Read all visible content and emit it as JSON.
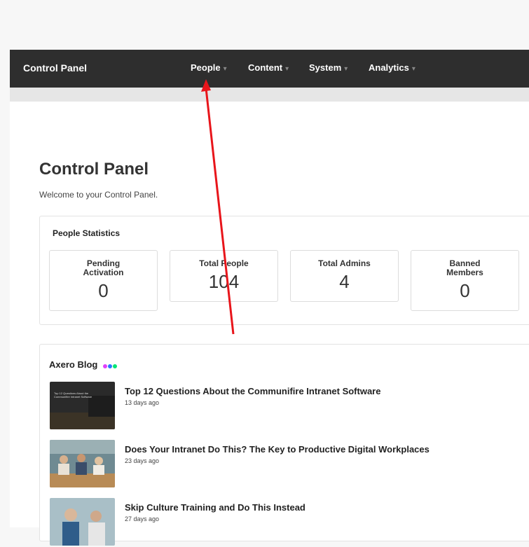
{
  "navbar": {
    "brand": "Control Panel",
    "items": [
      {
        "label": "People"
      },
      {
        "label": "Content"
      },
      {
        "label": "System"
      },
      {
        "label": "Analytics"
      }
    ],
    "caret": "▾"
  },
  "page": {
    "title": "Control Panel",
    "welcome": "Welcome to your Control Panel."
  },
  "stats": {
    "title": "People Statistics",
    "items": [
      {
        "label_line1": "Pending",
        "label_line2": "Activation",
        "value": "0"
      },
      {
        "label_line1": "Total People",
        "label_line2": "",
        "value": "104"
      },
      {
        "label_line1": "Total Admins",
        "label_line2": "",
        "value": "4"
      },
      {
        "label_line1": "Banned",
        "label_line2": "Members",
        "value": "0"
      }
    ]
  },
  "blog": {
    "title": "Axero Blog",
    "dot_colors": [
      "#e040fb",
      "#2979ff",
      "#00e676"
    ],
    "posts": [
      {
        "title": "Top 12 Questions About the Communifire Intranet Software",
        "date": "13 days ago",
        "thumb_text": "Top 12 Questions About the Communifire Intranet Software"
      },
      {
        "title": "Does Your Intranet Do This? The Key to Productive Digital Workplaces",
        "date": "23 days ago"
      },
      {
        "title": "Skip Culture Training and Do This Instead",
        "date": "27 days ago"
      }
    ]
  },
  "colors": {
    "navbar_bg": "#2e2e2e",
    "arrow": "#e8151b"
  }
}
